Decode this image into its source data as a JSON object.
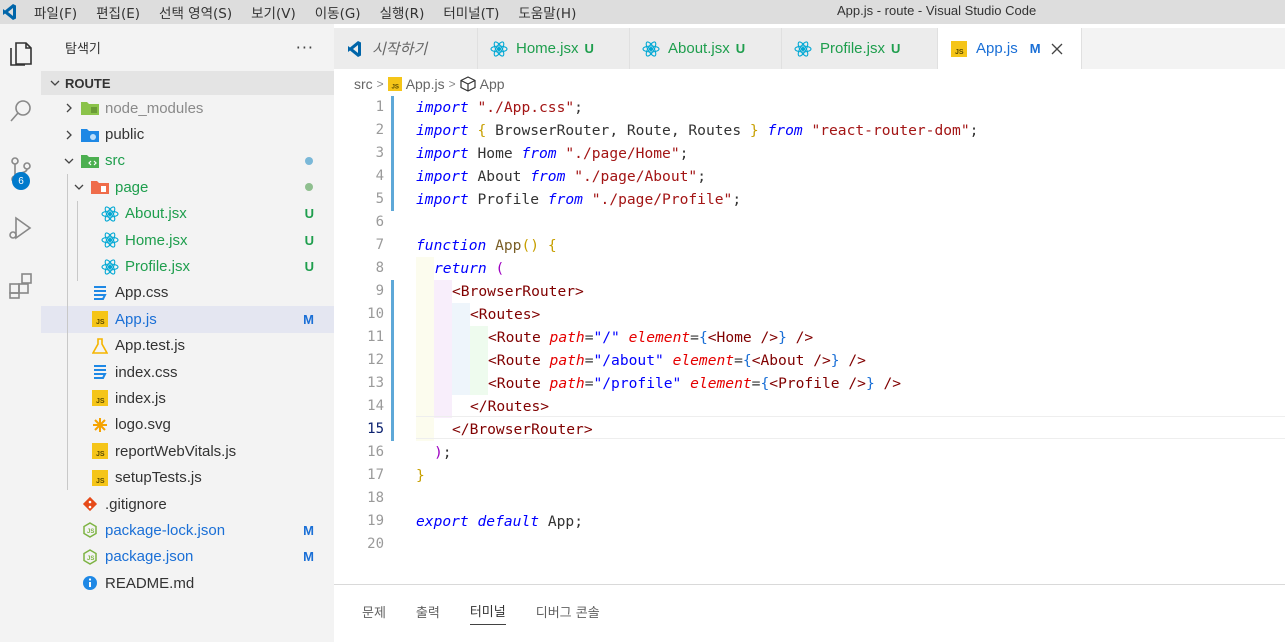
{
  "window": {
    "title": "App.js - route - Visual Studio Code",
    "menu": [
      "파일(F)",
      "편집(E)",
      "선택 영역(S)",
      "보기(V)",
      "이동(G)",
      "실행(R)",
      "터미널(T)",
      "도움말(H)"
    ]
  },
  "activity_bar": {
    "items": [
      "explorer-icon",
      "search-icon",
      "source-control-icon",
      "run-debug-icon",
      "extensions-icon"
    ],
    "source_control_badge": "6"
  },
  "sidebar": {
    "title": "탐색기",
    "more": "···",
    "root": "ROUTE",
    "items": [
      {
        "label": "node_modules",
        "type": "folder",
        "color": "#8a8a8a"
      },
      {
        "label": "public",
        "type": "folder",
        "color": "#333333"
      },
      {
        "label": "src",
        "type": "folder",
        "color": "#1e9e4d"
      },
      {
        "label": "page",
        "type": "folder",
        "color": "#1e9e4d"
      },
      {
        "label": "About.jsx",
        "type": "react",
        "status": "U",
        "color": "#1e9e4d"
      },
      {
        "label": "Home.jsx",
        "type": "react",
        "status": "U",
        "color": "#1e9e4d"
      },
      {
        "label": "Profile.jsx",
        "type": "react",
        "status": "U",
        "color": "#1e9e4d"
      },
      {
        "label": "App.css",
        "type": "css",
        "color": "#333333"
      },
      {
        "label": "App.js",
        "type": "js",
        "status": "M",
        "color": "#1a6fd6"
      },
      {
        "label": "App.test.js",
        "type": "test",
        "color": "#333333"
      },
      {
        "label": "index.css",
        "type": "css",
        "color": "#333333"
      },
      {
        "label": "index.js",
        "type": "js",
        "color": "#333333"
      },
      {
        "label": "logo.svg",
        "type": "svg",
        "color": "#333333"
      },
      {
        "label": "reportWebVitals.js",
        "type": "js",
        "color": "#333333"
      },
      {
        "label": "setupTests.js",
        "type": "js",
        "color": "#333333"
      },
      {
        "label": ".gitignore",
        "type": "git",
        "color": "#333333"
      },
      {
        "label": "package-lock.json",
        "type": "json",
        "status": "M",
        "color": "#1a6fd6"
      },
      {
        "label": "package.json",
        "type": "json",
        "status": "M",
        "color": "#1a6fd6"
      },
      {
        "label": "README.md",
        "type": "info",
        "color": "#333333"
      }
    ]
  },
  "tabs": [
    {
      "label": "시작하기",
      "icon": "vscode-icon",
      "status": ""
    },
    {
      "label": "Home.jsx",
      "icon": "react-icon",
      "status": "U"
    },
    {
      "label": "About.jsx",
      "icon": "react-icon",
      "status": "U"
    },
    {
      "label": "Profile.jsx",
      "icon": "react-icon",
      "status": "U"
    },
    {
      "label": "App.js",
      "icon": "js-icon",
      "status": "M",
      "active": true
    }
  ],
  "breadcrumb": [
    "src",
    "App.js",
    "App"
  ],
  "editor": {
    "line_numbers": [
      "1",
      "2",
      "3",
      "4",
      "5",
      "6",
      "7",
      "8",
      "9",
      "10",
      "11",
      "12",
      "13",
      "14",
      "15",
      "16",
      "17",
      "18",
      "19",
      "20"
    ],
    "current_line": "15",
    "code": {
      "l1": [
        "import",
        " ",
        "\"./App.css\"",
        ";"
      ],
      "l2": [
        "import",
        " ",
        "{",
        " BrowserRouter, Route, Routes ",
        "}",
        " ",
        "from",
        " ",
        "\"react-router-dom\"",
        ";"
      ],
      "l3": [
        "import",
        " Home ",
        "from",
        " ",
        "\"./page/Home\"",
        ";"
      ],
      "l4": [
        "import",
        " About ",
        "from",
        " ",
        "\"./page/About\"",
        ";"
      ],
      "l5": [
        "import",
        " Profile ",
        "from",
        " ",
        "\"./page/Profile\"",
        ";"
      ],
      "l7": [
        "function",
        " ",
        "App",
        "(",
        ")",
        " ",
        "{"
      ],
      "l8": [
        "return",
        " ",
        "("
      ],
      "l9": [
        "<",
        "BrowserRouter",
        ">"
      ],
      "l10": [
        "<",
        "Routes",
        ">"
      ],
      "l11": [
        "<",
        "Route",
        " ",
        "path",
        "=",
        "\"/\"",
        " ",
        "element",
        "=",
        "{",
        "<",
        "Home",
        " />",
        "}",
        " />"
      ],
      "l12": [
        "<",
        "Route",
        " ",
        "path",
        "=",
        "\"/about\"",
        " ",
        "element",
        "=",
        "{",
        "<",
        "About",
        " />",
        "}",
        " />"
      ],
      "l13": [
        "<",
        "Route",
        " ",
        "path",
        "=",
        "\"/profile\"",
        " ",
        "element",
        "=",
        "{",
        "<",
        "Profile",
        " />",
        "}",
        " />"
      ],
      "l14": [
        "</",
        "Routes",
        ">"
      ],
      "l15": [
        "</",
        "BrowserRouter",
        ">"
      ],
      "l16": [
        ")",
        ";"
      ],
      "l17": [
        "}"
      ],
      "l19": [
        "export",
        " ",
        "default",
        " App",
        ";"
      ]
    }
  },
  "panel": {
    "tabs": [
      "문제",
      "출력",
      "터미널",
      "디버그 콘솔"
    ],
    "active": "터미널"
  },
  "colors": {
    "accent": "#007acc",
    "untracked": "#1e9e4d",
    "modified": "#1a6fd6",
    "keyword": "#0000ff",
    "string": "#a31515",
    "tag": "#800000"
  }
}
